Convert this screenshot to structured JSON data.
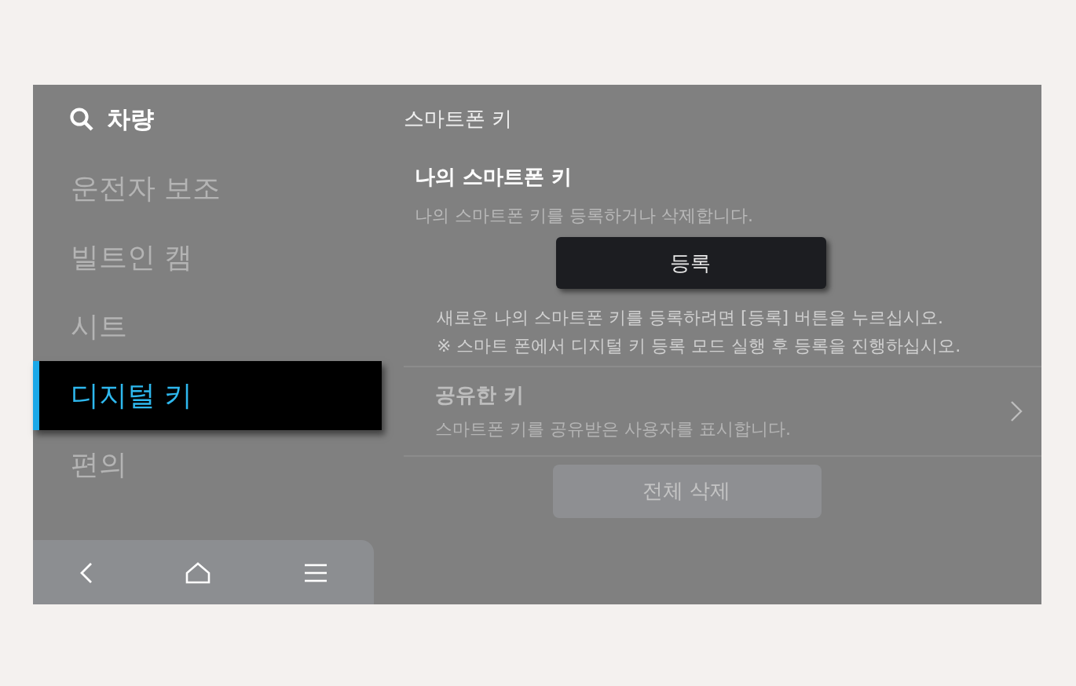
{
  "sidebar": {
    "title": "차량",
    "items": [
      {
        "label": "운전자 보조",
        "selected": false
      },
      {
        "label": "빌트인 캠",
        "selected": false
      },
      {
        "label": "시트",
        "selected": false
      },
      {
        "label": "디지털 키",
        "selected": true
      },
      {
        "label": "편의",
        "selected": false
      }
    ]
  },
  "content": {
    "title": "스마트폰 키",
    "my_key": {
      "title": "나의 스마트폰 키",
      "description": "나의 스마트폰 키를 등록하거나 삭제합니다.",
      "button": {
        "label": "등록",
        "disabled": false
      },
      "notes": [
        "새로운 나의 스마트폰 키를 등록하려면 [등록] 버튼을 누르십시오.",
        "※ 스마트 폰에서 디지털 키 등록 모드 실행 후 등록을 진행하십시오."
      ]
    },
    "shared_key": {
      "title": "공유한 키",
      "description": "스마트폰 키를 공유받은 사용자를 표시합니다.",
      "disabled": true
    },
    "delete_all": {
      "label": "전체 삭제",
      "disabled": true
    }
  }
}
